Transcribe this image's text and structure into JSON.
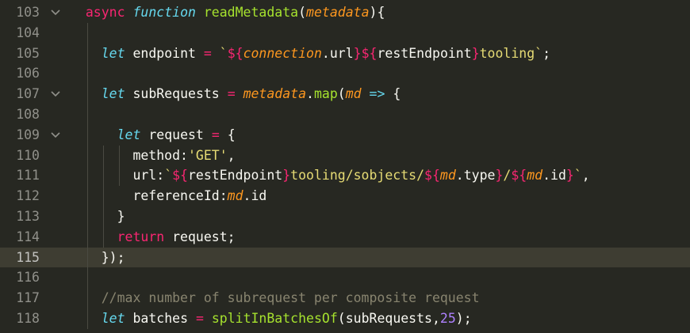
{
  "editor": {
    "current_line": "115",
    "lines": [
      {
        "num": "103",
        "fold": true,
        "indent": 2,
        "tokens": [
          {
            "t": "async ",
            "c": "kw"
          },
          {
            "t": "function ",
            "c": "kw2"
          },
          {
            "t": "readMetadata",
            "c": "fn"
          },
          {
            "t": "(",
            "c": "plain"
          },
          {
            "t": "metadata",
            "c": "param"
          },
          {
            "t": "){",
            "c": "plain"
          }
        ]
      },
      {
        "num": "104",
        "fold": false,
        "indent": 0,
        "tokens": []
      },
      {
        "num": "105",
        "fold": false,
        "indent": 4,
        "tokens": [
          {
            "t": "let ",
            "c": "kw2"
          },
          {
            "t": "endpoint ",
            "c": "plain"
          },
          {
            "t": "= ",
            "c": "op"
          },
          {
            "t": "`",
            "c": "str"
          },
          {
            "t": "${",
            "c": "tpl"
          },
          {
            "t": "connection",
            "c": "param"
          },
          {
            "t": ".url",
            "c": "plain"
          },
          {
            "t": "}",
            "c": "tpl"
          },
          {
            "t": "${",
            "c": "tpl"
          },
          {
            "t": "restEndpoint",
            "c": "plain"
          },
          {
            "t": "}",
            "c": "tpl"
          },
          {
            "t": "tooling`",
            "c": "str"
          },
          {
            "t": ";",
            "c": "plain"
          }
        ]
      },
      {
        "num": "106",
        "fold": false,
        "indent": 0,
        "tokens": []
      },
      {
        "num": "107",
        "fold": true,
        "indent": 4,
        "tokens": [
          {
            "t": "let ",
            "c": "kw2"
          },
          {
            "t": "subRequests ",
            "c": "plain"
          },
          {
            "t": "= ",
            "c": "op"
          },
          {
            "t": "metadata",
            "c": "param"
          },
          {
            "t": ".",
            "c": "plain"
          },
          {
            "t": "map",
            "c": "fn"
          },
          {
            "t": "(",
            "c": "plain"
          },
          {
            "t": "md ",
            "c": "param"
          },
          {
            "t": "=> ",
            "c": "kw2"
          },
          {
            "t": "{",
            "c": "plain"
          }
        ]
      },
      {
        "num": "108",
        "fold": false,
        "indent": 0,
        "tokens": []
      },
      {
        "num": "109",
        "fold": true,
        "indent": 6,
        "tokens": [
          {
            "t": "let ",
            "c": "kw2"
          },
          {
            "t": "request ",
            "c": "plain"
          },
          {
            "t": "= ",
            "c": "op"
          },
          {
            "t": "{",
            "c": "plain"
          }
        ]
      },
      {
        "num": "110",
        "fold": false,
        "indent": 8,
        "tokens": [
          {
            "t": "method:",
            "c": "plain"
          },
          {
            "t": "'GET'",
            "c": "str"
          },
          {
            "t": ",",
            "c": "plain"
          }
        ]
      },
      {
        "num": "111",
        "fold": false,
        "indent": 8,
        "tokens": [
          {
            "t": "url:",
            "c": "plain"
          },
          {
            "t": "`",
            "c": "str"
          },
          {
            "t": "${",
            "c": "tpl"
          },
          {
            "t": "restEndpoint",
            "c": "plain"
          },
          {
            "t": "}",
            "c": "tpl"
          },
          {
            "t": "tooling/sobjects/",
            "c": "str"
          },
          {
            "t": "${",
            "c": "tpl"
          },
          {
            "t": "md",
            "c": "param"
          },
          {
            "t": ".type",
            "c": "plain"
          },
          {
            "t": "}",
            "c": "tpl"
          },
          {
            "t": "/",
            "c": "str"
          },
          {
            "t": "${",
            "c": "tpl"
          },
          {
            "t": "md",
            "c": "param"
          },
          {
            "t": ".id",
            "c": "plain"
          },
          {
            "t": "}",
            "c": "tpl"
          },
          {
            "t": "`",
            "c": "str"
          },
          {
            "t": ",",
            "c": "plain"
          }
        ]
      },
      {
        "num": "112",
        "fold": false,
        "indent": 8,
        "tokens": [
          {
            "t": "referenceId:",
            "c": "plain"
          },
          {
            "t": "md",
            "c": "param"
          },
          {
            "t": ".id",
            "c": "plain"
          }
        ]
      },
      {
        "num": "113",
        "fold": false,
        "indent": 6,
        "tokens": [
          {
            "t": "}",
            "c": "plain"
          }
        ]
      },
      {
        "num": "114",
        "fold": false,
        "indent": 6,
        "tokens": [
          {
            "t": "return ",
            "c": "kw"
          },
          {
            "t": "request;",
            "c": "plain"
          }
        ]
      },
      {
        "num": "115",
        "fold": false,
        "indent": 4,
        "tokens": [
          {
            "t": "});",
            "c": "plain"
          }
        ]
      },
      {
        "num": "116",
        "fold": false,
        "indent": 0,
        "tokens": []
      },
      {
        "num": "117",
        "fold": false,
        "indent": 4,
        "tokens": [
          {
            "t": "//max number of subrequest per composite request",
            "c": "cmt"
          }
        ]
      },
      {
        "num": "118",
        "fold": false,
        "indent": 4,
        "tokens": [
          {
            "t": "let ",
            "c": "kw2"
          },
          {
            "t": "batches ",
            "c": "plain"
          },
          {
            "t": "= ",
            "c": "op"
          },
          {
            "t": "splitInBatchesOf",
            "c": "fn"
          },
          {
            "t": "(subRequests,",
            "c": "plain"
          },
          {
            "t": "25",
            "c": "num"
          },
          {
            "t": ");",
            "c": "plain"
          }
        ]
      }
    ]
  }
}
